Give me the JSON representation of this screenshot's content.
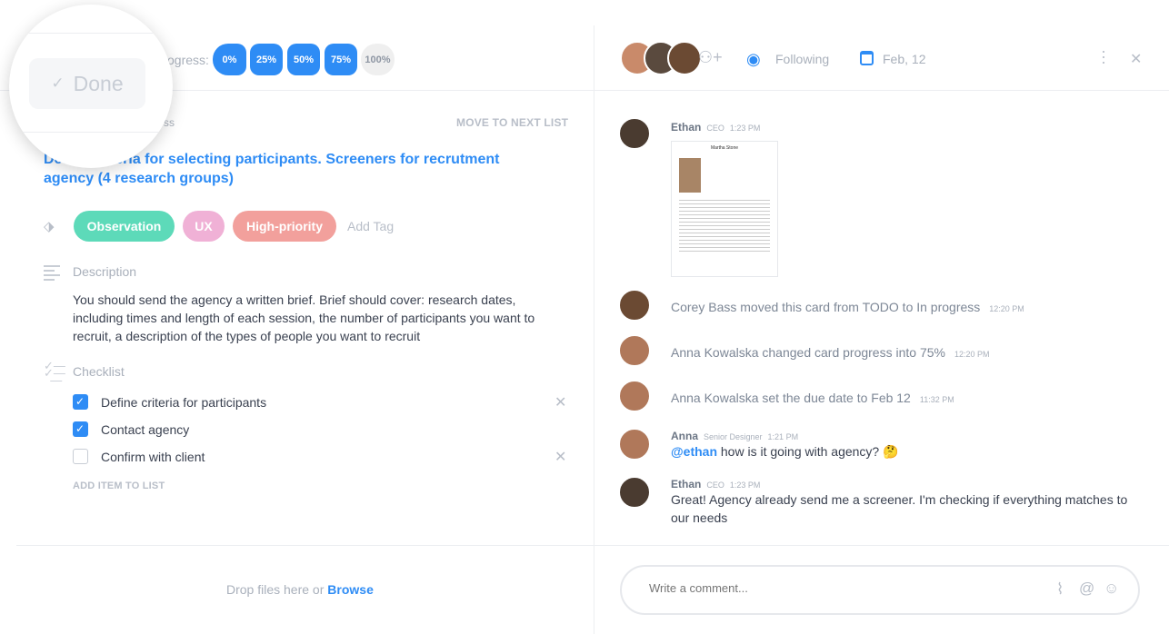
{
  "progress": {
    "label": "Progress:",
    "options": [
      "0%",
      "25%",
      "50%",
      "75%",
      "100%"
    ],
    "selected": "75%"
  },
  "magnifier": {
    "done_label": "Done"
  },
  "card": {
    "list_label": "In progress",
    "move_label": "MOVE TO NEXT LIST",
    "title": "Define criteria for selecting participants. Screeners for recrutment agency (4 research groups)"
  },
  "tags": {
    "items": [
      {
        "label": "Observation",
        "color": "#5ddab9"
      },
      {
        "label": "UX",
        "color": "#f0b1d6"
      },
      {
        "label": "High-priority",
        "color": "#f2a09c"
      }
    ],
    "add_label": "Add Tag"
  },
  "description": {
    "title": "Description",
    "text": "You should send the agency a written brief. Brief should cover:  research dates, including times and length of each session, the number of participants you want to recruit, a description of the types of people you want to recruit"
  },
  "checklist": {
    "title": "Checklist",
    "items": [
      {
        "label": "Define criteria for participants",
        "checked": true
      },
      {
        "label": "Contact agency",
        "checked": true
      },
      {
        "label": "Confirm with client",
        "checked": false
      }
    ],
    "add_label": "ADD ITEM TO LIST"
  },
  "dropzone": {
    "text": "Drop files here or ",
    "link": "Browse"
  },
  "header": {
    "following": "Following",
    "due": "Feb, 12"
  },
  "activity": [
    {
      "type": "message",
      "name": "Ethan",
      "role": "CEO",
      "time": "1:23 PM",
      "attachment_title": "Martha Stone"
    },
    {
      "type": "event",
      "text": "Corey Bass moved this card from TODO to In progress",
      "time": "12:20 PM"
    },
    {
      "type": "event",
      "text": "Anna Kowalska changed card progress into 75%",
      "time": "12:20 PM"
    },
    {
      "type": "event",
      "text": "Anna Kowalska set the due date to Feb 12",
      "time": "11:32 PM"
    },
    {
      "type": "message",
      "name": "Anna",
      "role": "Senior Designer",
      "time": "1:21 PM",
      "mention": "@ethan",
      "text": " how is it going with agency? 🤔"
    },
    {
      "type": "message",
      "name": "Ethan",
      "role": "CEO",
      "time": "1:23 PM",
      "text": "Great! Agency already send me a screener. I'm checking if everything matches to our needs"
    }
  ],
  "comment": {
    "placeholder": "Write a comment..."
  },
  "colors": {
    "accent": "#2e8cf5"
  }
}
